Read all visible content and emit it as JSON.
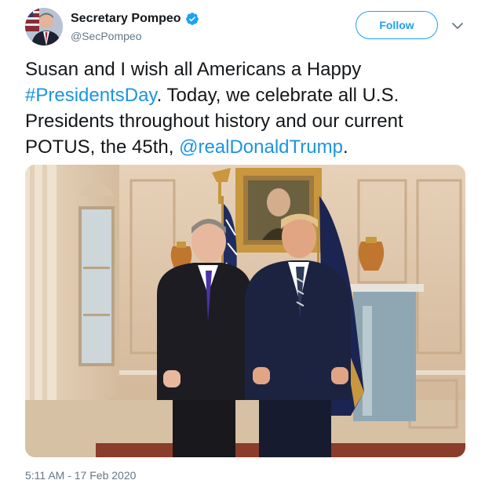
{
  "author": {
    "display_name": "Secretary Pompeo",
    "handle": "@SecPompeo",
    "verified_icon": "verified-badge-icon",
    "avatar_icon": "profile-avatar"
  },
  "actions": {
    "follow_label": "Follow",
    "more_icon": "chevron-down-icon"
  },
  "tweet": {
    "part1": "Susan and I wish all Americans a Happy ",
    "hashtag": "#PresidentsDay",
    "part2": ". Today, we celebrate all U.S. Presidents throughout history and our current POTUS, the 45th, ",
    "mention": "@realDonaldTrump",
    "part3": "."
  },
  "media": {
    "kind": "photo"
  },
  "timestamp": "5:11 AM - 17 Feb 2020",
  "colors": {
    "accent": "#1da1f2",
    "link": "#1b95e0",
    "muted": "#657786",
    "text": "#14171a"
  }
}
